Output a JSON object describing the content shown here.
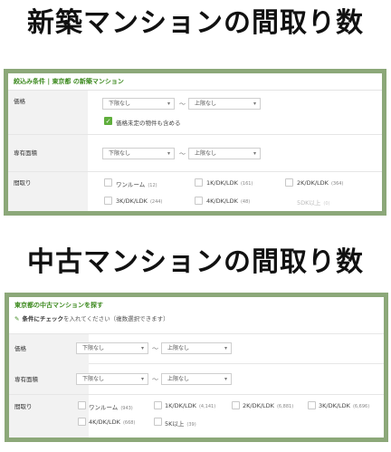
{
  "headings": {
    "new": "新築マンションの間取り数",
    "used": "中古マンションの間取り数"
  },
  "panel_new": {
    "title_prefix": "絞込み条件",
    "title_sep": "|",
    "title_rest": "東京都 の新築マンション",
    "price_label": "価格",
    "price_min": "下限なし",
    "price_max": "上限なし",
    "tilde": "〜",
    "undecided_checked": true,
    "undecided_label": "価格未定の物件も含める",
    "area_label": "専有面積",
    "area_min": "下限なし",
    "area_max": "上限なし",
    "layout_label": "間取り",
    "layouts": [
      {
        "name": "ワンルーム",
        "count": "(12)"
      },
      {
        "name": "1K/DK/LDK",
        "count": "(161)"
      },
      {
        "name": "2K/DK/LDK",
        "count": "(364)"
      },
      {
        "name": "3K/DK/LDK",
        "count": "(244)"
      },
      {
        "name": "4K/DK/LDK",
        "count": "(48)"
      },
      {
        "name": "5DK以上",
        "count": "(0)"
      }
    ]
  },
  "panel_used": {
    "title": "東京都の中古マンションを探す",
    "note_bold": "条件にチェック",
    "note_rest": "を入れてください（複数選択できます）",
    "price_label": "価格",
    "price_min": "下限なし",
    "price_max": "上限なし",
    "tilde": "〜",
    "area_label": "専有面積",
    "area_min": "下限なし",
    "area_max": "上限なし",
    "layout_label": "間取り",
    "layouts": [
      {
        "name": "ワンルーム",
        "count": "(943)"
      },
      {
        "name": "1K/DK/LDK",
        "count": "(4,141)"
      },
      {
        "name": "2K/DK/LDK",
        "count": "(6,881)"
      },
      {
        "name": "3K/DK/LDK",
        "count": "(6,696)"
      },
      {
        "name": "4K/DK/LDK",
        "count": "(668)"
      },
      {
        "name": "5K以上",
        "count": "(39)"
      }
    ]
  },
  "colors": {
    "panel_border": "#8ca879",
    "accent_green": "#3d8a1f",
    "checkbox_checked": "#5fae3c"
  }
}
